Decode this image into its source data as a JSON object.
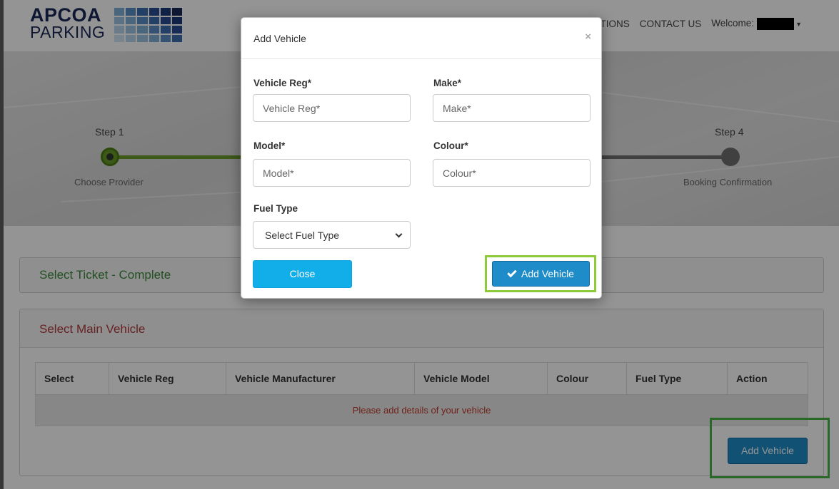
{
  "header": {
    "logo_line1": "APCOA",
    "logo_line2": "PARKING",
    "nav_items": [
      "DITIONS",
      "CONTACT US"
    ],
    "welcome_label": "Welcome:"
  },
  "steps": {
    "step1_title": "Step 1",
    "step1_label": "Choose Provider",
    "step4_title": "Step 4",
    "step4_label": "Booking Confirmation"
  },
  "ticket_panel": {
    "title": "Select Ticket - Complete"
  },
  "vehicle_panel": {
    "title": "Select Main Vehicle",
    "columns": [
      "Select",
      "Vehicle Reg",
      "Vehicle Manufacturer",
      "Vehicle Model",
      "Colour",
      "Fuel Type",
      "Action"
    ],
    "empty_message": "Please add details of your vehicle",
    "add_button": "Add Vehicle"
  },
  "modal": {
    "title": "Add Vehicle",
    "close_icon": "×",
    "fields": {
      "reg": {
        "label": "Vehicle Reg*",
        "placeholder": "Vehicle Reg*",
        "value": ""
      },
      "make": {
        "label": "Make*",
        "placeholder": "Make*",
        "value": ""
      },
      "model": {
        "label": "Model*",
        "placeholder": "Model*",
        "value": ""
      },
      "colour": {
        "label": "Colour*",
        "placeholder": "Colour*",
        "value": ""
      },
      "fuel": {
        "label": "Fuel Type",
        "selected": "Select Fuel Type"
      }
    },
    "close_button": "Close",
    "add_button": "Add Vehicle"
  },
  "colors": {
    "primary_button": "#1e8cc9",
    "close_button": "#12aeea",
    "progress_green": "#6a9a2a",
    "highlight_green": "#47b445",
    "success_text": "#3c8a3c",
    "warning_text": "#b03a3a"
  },
  "icons": {
    "modal_close": "close-icon",
    "add_button_check": "checkmark-icon",
    "select_chevron": "chevron-down-icon",
    "user_menu": "caret-down-icon"
  }
}
